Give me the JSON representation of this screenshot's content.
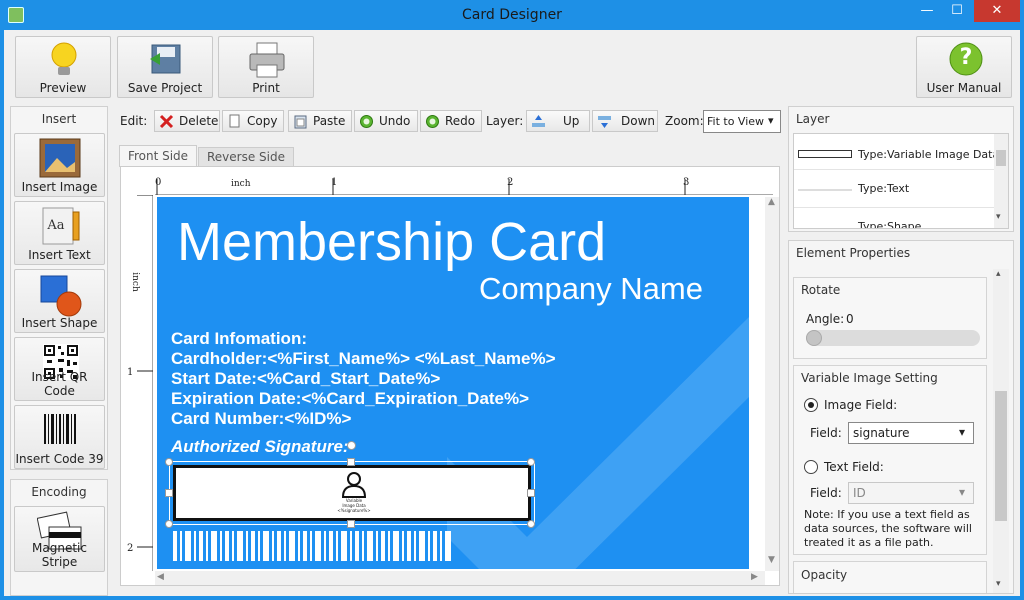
{
  "window": {
    "title": "Card Designer",
    "min_glyph": "—",
    "max_glyph": "☐",
    "close_glyph": "✕"
  },
  "toolbar": {
    "preview": "Preview",
    "save": "Save Project",
    "print": "Print",
    "manual": "User Manual",
    "manual_glyph": "?"
  },
  "insert": {
    "header": "Insert",
    "image": "Insert Image",
    "text": "Insert Text",
    "text_glyph": "Aa",
    "shape": "Insert Shape",
    "qr": "Insert QR Code",
    "code39": "Insert Code 39"
  },
  "encoding": {
    "header": "Encoding",
    "stripe": "Magnetic Stripe"
  },
  "edit": {
    "label": "Edit:",
    "delete": "Delete",
    "copy": "Copy",
    "paste": "Paste",
    "undo": "Undo",
    "redo": "Redo",
    "layer_label": "Layer:",
    "up": "Up",
    "down": "Down",
    "zoom_label": "Zoom:",
    "zoom_value": "Fit to View"
  },
  "tabs": {
    "front": "Front Side",
    "reverse": "Reverse Side"
  },
  "ruler": {
    "unit": "inch",
    "h_ticks": [
      "0",
      "1",
      "2",
      "3"
    ],
    "v_ticks": [
      "1",
      "2"
    ]
  },
  "card": {
    "title": "Membership Card",
    "company": "Company Name",
    "lines": [
      "Card Infomation:",
      "Cardholder:<%First_Name%> <%Last_Name%>",
      "Start Date:<%Card_Start_Date%>",
      "Expiration Date:<%Card_Expiration_Date%>",
      "Card Number:<%ID%>"
    ],
    "signature_label": "Authorized Signature:",
    "image_caption_1": "Variable",
    "image_caption_2": "Image Data",
    "image_caption_3": "<%signature%>",
    "colors": {
      "background": "#1e90f2",
      "text": "#ffffff"
    }
  },
  "layer": {
    "header": "Layer",
    "items": [
      "Type:Variable Image Data",
      "Type:Text",
      "Type:Shape"
    ]
  },
  "properties": {
    "header": "Element Properties",
    "rotate_header": "Rotate",
    "angle_label": "Angle:",
    "angle_value": "0",
    "variable_header": "Variable Image Setting",
    "image_field_label": "Image Field:",
    "field_label": "Field:",
    "image_field_value": "signature",
    "text_field_label": "Text Field:",
    "text_field_value": "ID",
    "note": "Note: If you use a text field as data sources, the software will treated it as a file path.",
    "opacity_header": "Opacity"
  }
}
